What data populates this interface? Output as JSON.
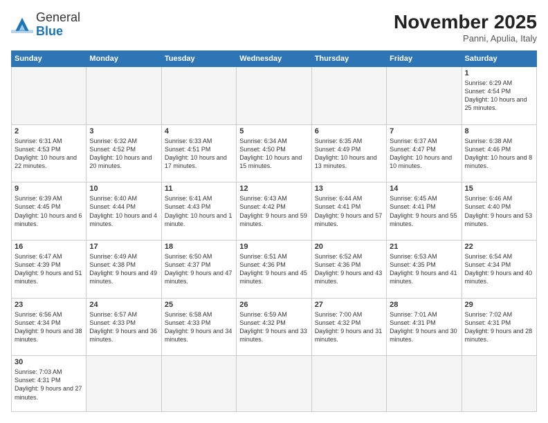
{
  "header": {
    "logo_general": "General",
    "logo_blue": "Blue",
    "month_title": "November 2025",
    "subtitle": "Panni, Apulia, Italy"
  },
  "weekdays": [
    "Sunday",
    "Monday",
    "Tuesday",
    "Wednesday",
    "Thursday",
    "Friday",
    "Saturday"
  ],
  "weeks": [
    [
      {
        "day": "",
        "info": ""
      },
      {
        "day": "",
        "info": ""
      },
      {
        "day": "",
        "info": ""
      },
      {
        "day": "",
        "info": ""
      },
      {
        "day": "",
        "info": ""
      },
      {
        "day": "",
        "info": ""
      },
      {
        "day": "1",
        "info": "Sunrise: 6:29 AM\nSunset: 4:54 PM\nDaylight: 10 hours\nand 25 minutes."
      }
    ],
    [
      {
        "day": "2",
        "info": "Sunrise: 6:31 AM\nSunset: 4:53 PM\nDaylight: 10 hours\nand 22 minutes."
      },
      {
        "day": "3",
        "info": "Sunrise: 6:32 AM\nSunset: 4:52 PM\nDaylight: 10 hours\nand 20 minutes."
      },
      {
        "day": "4",
        "info": "Sunrise: 6:33 AM\nSunset: 4:51 PM\nDaylight: 10 hours\nand 17 minutes."
      },
      {
        "day": "5",
        "info": "Sunrise: 6:34 AM\nSunset: 4:50 PM\nDaylight: 10 hours\nand 15 minutes."
      },
      {
        "day": "6",
        "info": "Sunrise: 6:35 AM\nSunset: 4:49 PM\nDaylight: 10 hours\nand 13 minutes."
      },
      {
        "day": "7",
        "info": "Sunrise: 6:37 AM\nSunset: 4:47 PM\nDaylight: 10 hours\nand 10 minutes."
      },
      {
        "day": "8",
        "info": "Sunrise: 6:38 AM\nSunset: 4:46 PM\nDaylight: 10 hours\nand 8 minutes."
      }
    ],
    [
      {
        "day": "9",
        "info": "Sunrise: 6:39 AM\nSunset: 4:45 PM\nDaylight: 10 hours\nand 6 minutes."
      },
      {
        "day": "10",
        "info": "Sunrise: 6:40 AM\nSunset: 4:44 PM\nDaylight: 10 hours\nand 4 minutes."
      },
      {
        "day": "11",
        "info": "Sunrise: 6:41 AM\nSunset: 4:43 PM\nDaylight: 10 hours\nand 1 minute."
      },
      {
        "day": "12",
        "info": "Sunrise: 6:43 AM\nSunset: 4:42 PM\nDaylight: 9 hours\nand 59 minutes."
      },
      {
        "day": "13",
        "info": "Sunrise: 6:44 AM\nSunset: 4:41 PM\nDaylight: 9 hours\nand 57 minutes."
      },
      {
        "day": "14",
        "info": "Sunrise: 6:45 AM\nSunset: 4:41 PM\nDaylight: 9 hours\nand 55 minutes."
      },
      {
        "day": "15",
        "info": "Sunrise: 6:46 AM\nSunset: 4:40 PM\nDaylight: 9 hours\nand 53 minutes."
      }
    ],
    [
      {
        "day": "16",
        "info": "Sunrise: 6:47 AM\nSunset: 4:39 PM\nDaylight: 9 hours\nand 51 minutes."
      },
      {
        "day": "17",
        "info": "Sunrise: 6:49 AM\nSunset: 4:38 PM\nDaylight: 9 hours\nand 49 minutes."
      },
      {
        "day": "18",
        "info": "Sunrise: 6:50 AM\nSunset: 4:37 PM\nDaylight: 9 hours\nand 47 minutes."
      },
      {
        "day": "19",
        "info": "Sunrise: 6:51 AM\nSunset: 4:36 PM\nDaylight: 9 hours\nand 45 minutes."
      },
      {
        "day": "20",
        "info": "Sunrise: 6:52 AM\nSunset: 4:36 PM\nDaylight: 9 hours\nand 43 minutes."
      },
      {
        "day": "21",
        "info": "Sunrise: 6:53 AM\nSunset: 4:35 PM\nDaylight: 9 hours\nand 41 minutes."
      },
      {
        "day": "22",
        "info": "Sunrise: 6:54 AM\nSunset: 4:34 PM\nDaylight: 9 hours\nand 40 minutes."
      }
    ],
    [
      {
        "day": "23",
        "info": "Sunrise: 6:56 AM\nSunset: 4:34 PM\nDaylight: 9 hours\nand 38 minutes."
      },
      {
        "day": "24",
        "info": "Sunrise: 6:57 AM\nSunset: 4:33 PM\nDaylight: 9 hours\nand 36 minutes."
      },
      {
        "day": "25",
        "info": "Sunrise: 6:58 AM\nSunset: 4:33 PM\nDaylight: 9 hours\nand 34 minutes."
      },
      {
        "day": "26",
        "info": "Sunrise: 6:59 AM\nSunset: 4:32 PM\nDaylight: 9 hours\nand 33 minutes."
      },
      {
        "day": "27",
        "info": "Sunrise: 7:00 AM\nSunset: 4:32 PM\nDaylight: 9 hours\nand 31 minutes."
      },
      {
        "day": "28",
        "info": "Sunrise: 7:01 AM\nSunset: 4:31 PM\nDaylight: 9 hours\nand 30 minutes."
      },
      {
        "day": "29",
        "info": "Sunrise: 7:02 AM\nSunset: 4:31 PM\nDaylight: 9 hours\nand 28 minutes."
      }
    ],
    [
      {
        "day": "30",
        "info": "Sunrise: 7:03 AM\nSunset: 4:31 PM\nDaylight: 9 hours\nand 27 minutes."
      },
      {
        "day": "",
        "info": ""
      },
      {
        "day": "",
        "info": ""
      },
      {
        "day": "",
        "info": ""
      },
      {
        "day": "",
        "info": ""
      },
      {
        "day": "",
        "info": ""
      },
      {
        "day": "",
        "info": ""
      }
    ]
  ]
}
